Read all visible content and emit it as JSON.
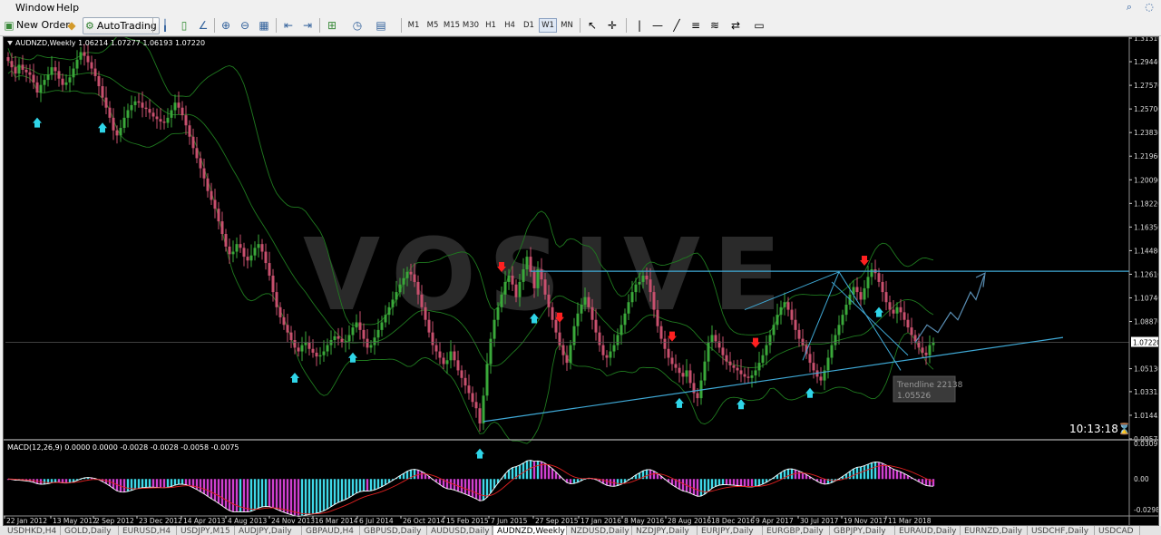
{
  "menu": {
    "items": [
      "Window",
      "Help"
    ]
  },
  "toolbar": {
    "new_order": "New Order",
    "autotrading": "AutoTrading",
    "timeframes": [
      "M1",
      "M5",
      "M15",
      "M30",
      "H1",
      "H4",
      "D1",
      "W1",
      "MN"
    ],
    "selected_timeframe": "W1"
  },
  "chart": {
    "info": "AUDNZD,Weekly  1.06214 1.07277 1.06193 1.07220",
    "watermark": "VOSIVE",
    "clock": "10:13:18",
    "trendline_label": "Trendline 22138",
    "trendline_value": "1.05526",
    "macd_info": "MACD(12,26,9) 0.0000 0.0000 -0.0028 -0.0028 -0.0058 -0.0075"
  },
  "chart_data": [
    {
      "type": "candlestick",
      "title": "AUDNZD,Weekly",
      "ylim": [
        0.99575,
        1.3131
      ],
      "y_ticks": [
        "1.31310",
        "1.29440",
        "1.27570",
        "1.25700",
        "1.23830",
        "1.21960",
        "1.20090",
        "1.18220",
        "1.16350",
        "1.14480",
        "1.12610",
        "1.10740",
        "1.08870",
        "1.07220",
        "1.05130",
        "1.03315",
        "1.01445",
        "0.99575"
      ],
      "current_price": "1.07220",
      "x_ticks": [
        "22 Jan 2012",
        "13 May 2012",
        "2 Sep 2012",
        "23 Dec 2012",
        "14 Apr 2013",
        "4 Aug 2013",
        "24 Nov 2013",
        "16 Mar 2014",
        "6 Jul 2014",
        "26 Oct 2014",
        "15 Feb 2015",
        "7 Jun 2015",
        "27 Sep 2015",
        "17 Jan 2016",
        "8 May 2016",
        "28 Aug 2016",
        "18 Dec 2016",
        "9 Apr 2017",
        "30 Jul 2017",
        "19 Nov 2017",
        "11 Mar 2018"
      ],
      "closes": [
        1.295,
        1.29,
        1.285,
        1.292,
        1.288,
        1.286,
        1.284,
        1.278,
        1.27,
        1.276,
        1.28,
        1.284,
        1.29,
        1.287,
        1.281,
        1.276,
        1.278,
        1.282,
        1.289,
        1.296,
        1.302,
        1.299,
        1.294,
        1.289,
        1.283,
        1.275,
        1.266,
        1.258,
        1.25,
        1.24,
        1.236,
        1.242,
        1.25,
        1.256,
        1.26,
        1.263,
        1.262,
        1.258,
        1.257,
        1.254,
        1.251,
        1.249,
        1.247,
        1.246,
        1.25,
        1.256,
        1.262,
        1.258,
        1.252,
        1.244,
        1.235,
        1.226,
        1.218,
        1.21,
        1.202,
        1.192,
        1.185,
        1.178,
        1.168,
        1.158,
        1.148,
        1.142,
        1.144,
        1.15,
        1.147,
        1.14,
        1.137,
        1.141,
        1.147,
        1.15,
        1.144,
        1.135,
        1.125,
        1.112,
        1.1,
        1.092,
        1.086,
        1.08,
        1.074,
        1.068,
        1.065,
        1.07,
        1.072,
        1.067,
        1.064,
        1.061,
        1.062,
        1.065,
        1.07,
        1.074,
        1.077,
        1.075,
        1.072,
        1.073,
        1.078,
        1.084,
        1.088,
        1.082,
        1.075,
        1.068,
        1.07,
        1.076,
        1.082,
        1.088,
        1.094,
        1.1,
        1.106,
        1.112,
        1.118,
        1.123,
        1.128,
        1.126,
        1.12,
        1.11,
        1.1,
        1.09,
        1.08,
        1.07,
        1.065,
        1.06,
        1.055,
        1.058,
        1.065,
        1.058,
        1.05,
        1.044,
        1.038,
        1.032,
        1.025,
        1.02,
        1.008,
        1.03,
        1.055,
        1.075,
        1.09,
        1.1,
        1.11,
        1.12,
        1.125,
        1.118,
        1.108,
        1.12,
        1.13,
        1.14,
        1.128,
        1.115,
        1.13,
        1.122,
        1.11,
        1.1,
        1.09,
        1.08,
        1.07,
        1.062,
        1.056,
        1.07,
        1.085,
        1.095,
        1.102,
        1.108,
        1.1,
        1.09,
        1.08,
        1.07,
        1.062,
        1.06,
        1.065,
        1.07,
        1.078,
        1.086,
        1.095,
        1.104,
        1.112,
        1.118,
        1.12,
        1.125,
        1.122,
        1.112,
        1.098,
        1.085,
        1.075,
        1.067,
        1.06,
        1.055,
        1.052,
        1.048,
        1.045,
        1.05,
        1.04,
        1.032,
        1.028,
        1.042,
        1.057,
        1.072,
        1.078,
        1.073,
        1.068,
        1.062,
        1.057,
        1.054,
        1.052,
        1.05,
        1.047,
        1.045,
        1.044,
        1.046,
        1.05,
        1.056,
        1.062,
        1.07,
        1.078,
        1.086,
        1.094,
        1.1,
        1.104,
        1.098,
        1.09,
        1.082,
        1.075,
        1.07,
        1.063,
        1.056,
        1.05,
        1.045,
        1.042,
        1.05,
        1.06,
        1.07,
        1.078,
        1.086,
        1.094,
        1.102,
        1.11,
        1.116,
        1.112,
        1.106,
        1.115,
        1.124,
        1.13,
        1.127,
        1.12,
        1.112,
        1.104,
        1.098,
        1.095,
        1.1,
        1.096,
        1.09,
        1.084,
        1.078,
        1.073,
        1.068,
        1.064,
        1.062,
        1.07,
        1.072
      ],
      "upper_arrows_index": [
        20,
        136,
        152,
        183,
        206,
        236
      ],
      "lower_arrows_index": [
        8,
        26,
        79,
        95,
        130,
        145,
        185,
        202,
        221,
        240
      ],
      "horizontal_line": 1.1285,
      "trendline": {
        "from_index": 131,
        "from_price": 1.0095,
        "to_index": 281,
        "to_price": 1.072
      }
    },
    {
      "type": "bar",
      "title": "MACD(12,26,9)",
      "ylim": [
        -0.0298,
        0.0309
      ],
      "y_ticks": [
        "0.0309",
        "0.00",
        "-0.0298"
      ]
    }
  ],
  "tabs": [
    "USDHKD,H4",
    "GOLD,Daily",
    "EURUSD,H4",
    "USDJPY,M15",
    "AUDJPY,Daily",
    "GBPAUD,H4",
    "GBPUSD,Daily",
    "AUDUSD,Daily",
    "AUDNZD,Weekly",
    "NZDUSD,Daily",
    "NZDJPY,Daily",
    "EURJPY,Daily",
    "EURGBP,Daily",
    "GBPJPY,Daily",
    "EURAUD,Daily",
    "EURNZD,Daily",
    "USDCHF,Daily",
    "USDCAD"
  ],
  "active_tab": "AUDNZD,Weekly",
  "colors": {
    "up": "#3aa83a",
    "down": "#c8506e",
    "band": "#1f7a1f",
    "trend": "#3fa9d6",
    "arrow_up": "#2fd5e8",
    "arrow_down": "#ff2020",
    "macd_hist": "#3fd8e8"
  }
}
